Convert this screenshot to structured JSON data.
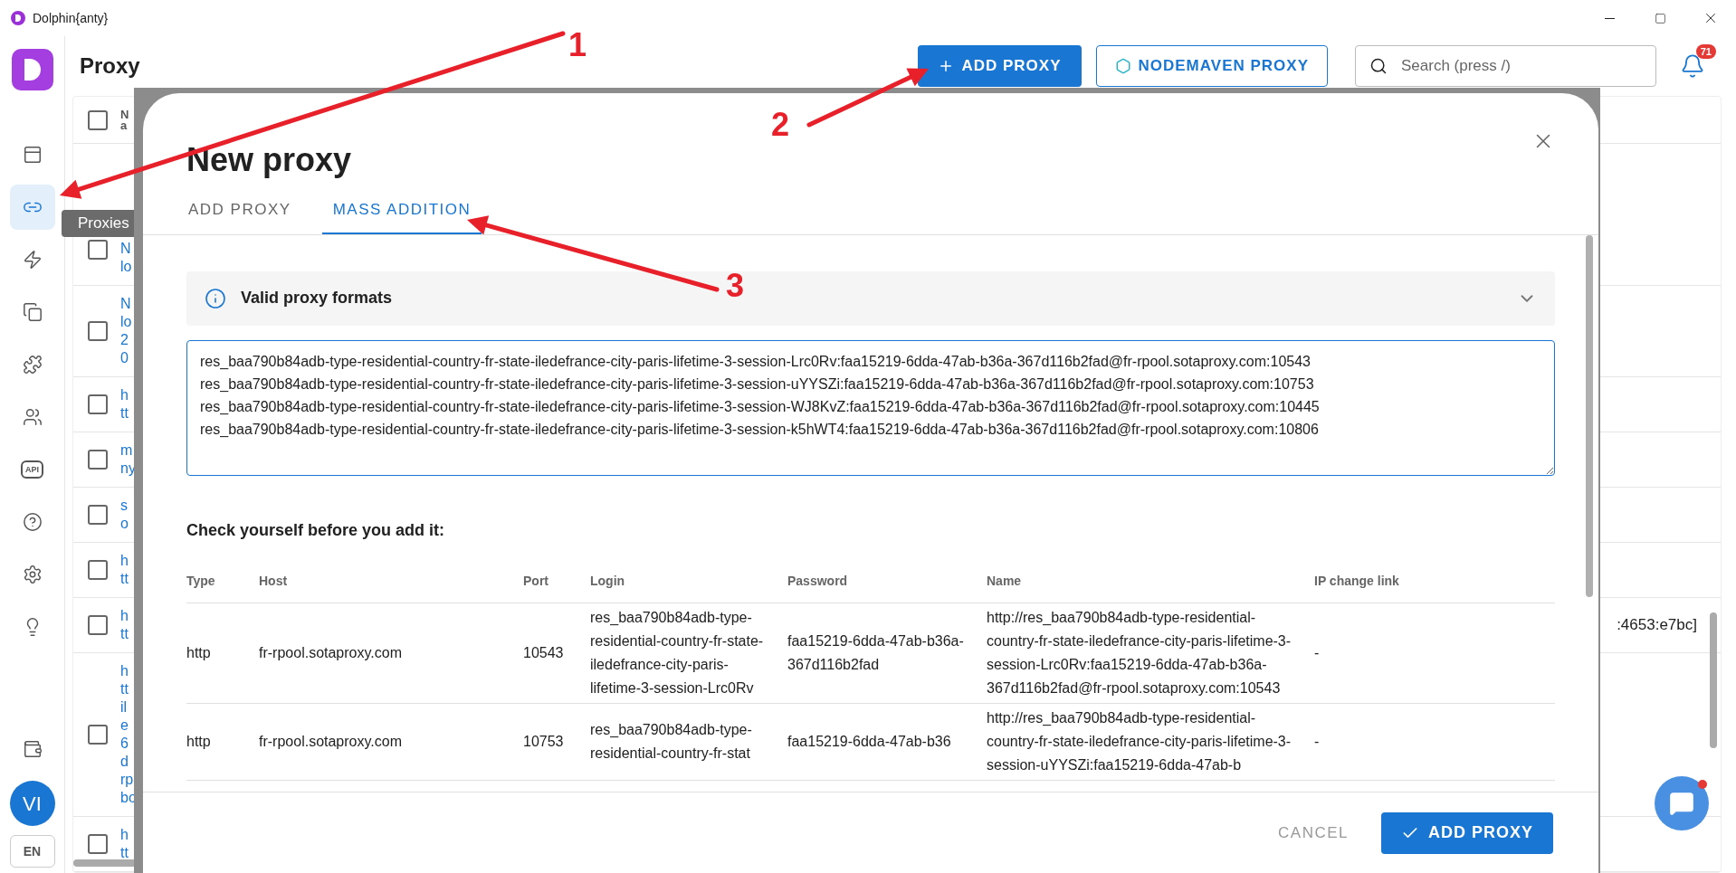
{
  "window": {
    "title": "Dolphin{anty}"
  },
  "sidebar": {
    "items": [
      {
        "kind": "browser",
        "selected": false
      },
      {
        "kind": "link",
        "selected": true
      },
      {
        "kind": "automation",
        "selected": false
      },
      {
        "kind": "bookmarks",
        "selected": false
      },
      {
        "kind": "extensions",
        "selected": false
      },
      {
        "kind": "team",
        "selected": false
      },
      {
        "kind": "api",
        "label": "API",
        "selected": false
      },
      {
        "kind": "help",
        "selected": false
      },
      {
        "kind": "settings",
        "selected": false
      },
      {
        "kind": "tips",
        "selected": false
      }
    ],
    "tooltip": "Proxies",
    "avatar": "VI",
    "language": "EN"
  },
  "header": {
    "title": "Proxy",
    "add_button": "ADD PROXY",
    "nodemaven_button": "NODEMAVEN PROXY",
    "search": {
      "placeholder": "Search (press /)"
    },
    "notifications": "71"
  },
  "background_table": {
    "header": [
      "N",
      "a"
    ],
    "header_checked": false,
    "rows": [
      {
        "lines": [
          "N",
          "lo"
        ],
        "checked": false
      },
      {
        "lines": [
          "N",
          "lo",
          "2",
          "0"
        ],
        "checked": false
      },
      {
        "lines": [
          "h",
          "tt"
        ],
        "checked": false
      },
      {
        "lines": [
          "m",
          "ny"
        ],
        "checked": false
      },
      {
        "lines": [
          "s",
          "o"
        ],
        "checked": false
      },
      {
        "lines": [
          "h",
          "tt"
        ],
        "checked": false
      },
      {
        "lines": [
          "h",
          "tt"
        ],
        "right": ":4653:e7bc]",
        "checked": false
      },
      {
        "lines": [
          "h",
          "tt",
          "il",
          "e",
          "6",
          "d",
          "rp",
          "bo"
        ],
        "checked": false
      },
      {
        "lines": [
          "h",
          "tt"
        ],
        "checked": false
      }
    ]
  },
  "modal": {
    "title": "New proxy",
    "tabs": [
      {
        "label": "ADD PROXY",
        "selected": false
      },
      {
        "label": "MASS ADDITION",
        "selected": true
      }
    ],
    "formats": {
      "title": "Valid proxy formats",
      "expanded": false
    },
    "textarea": "res_baa790b84adb-type-residential-country-fr-state-iledefrance-city-paris-lifetime-3-session-Lrc0Rv:faa15219-6dda-47ab-b36a-367d116b2fad@fr-rpool.sotaproxy.com:10543\nres_baa790b84adb-type-residential-country-fr-state-iledefrance-city-paris-lifetime-3-session-uYYSZi:faa15219-6dda-47ab-b36a-367d116b2fad@fr-rpool.sotaproxy.com:10753\nres_baa790b84adb-type-residential-country-fr-state-iledefrance-city-paris-lifetime-3-session-WJ8KvZ:faa15219-6dda-47ab-b36a-367d116b2fad@fr-rpool.sotaproxy.com:10445\nres_baa790b84adb-type-residential-country-fr-state-iledefrance-city-paris-lifetime-3-session-k5hWT4:faa15219-6dda-47ab-b36a-367d116b2fad@fr-rpool.sotaproxy.com:10806",
    "check_title": "Check yourself before you add it:",
    "table": {
      "columns": [
        "Type",
        "Host",
        "Port",
        "Login",
        "Password",
        "Name",
        "IP change link"
      ],
      "rows": [
        [
          "http",
          "fr-rpool.sotaproxy.com",
          "10543",
          "res_baa790b84adb-type-residential-country-fr-state-iledefrance-city-paris-lifetime-3-session-Lrc0Rv",
          "faa15219-6dda-47ab-b36a-367d116b2fad",
          "http://res_baa790b84adb-type-residential-country-fr-state-iledefrance-city-paris-lifetime-3-session-Lrc0Rv:faa15219-6dda-47ab-b36a-367d116b2fad@fr-rpool.sotaproxy.com:10543",
          "-"
        ],
        [
          "http",
          "fr-rpool.sotaproxy.com",
          "10753",
          "res_baa790b84adb-type-residential-country-fr-stat",
          "faa15219-6dda-47ab-b36",
          "http://res_baa790b84adb-type-residential-country-fr-state-iledefrance-city-paris-lifetime-3-session-uYYSZi:faa15219-6dda-47ab-b",
          "-"
        ]
      ]
    },
    "cancel": "CANCEL",
    "submit": "ADD PROXY"
  },
  "annotations": [
    {
      "label": "1"
    },
    {
      "label": "2"
    },
    {
      "label": "3"
    }
  ]
}
